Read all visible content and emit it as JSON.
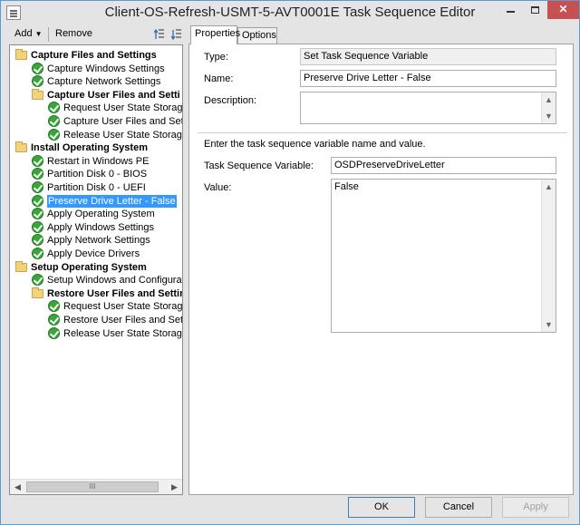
{
  "window": {
    "title": "Client-OS-Refresh-USMT-5-AVT0001E Task Sequence Editor"
  },
  "toolbar": {
    "add_label": "Add",
    "remove_label": "Remove"
  },
  "tree": {
    "items": [
      {
        "label": "Capture Files and Settings",
        "type": "group",
        "level": 0
      },
      {
        "label": "Capture Windows Settings",
        "type": "step",
        "level": 1
      },
      {
        "label": "Capture Network Settings",
        "type": "step",
        "level": 1
      },
      {
        "label": "Capture User Files and Setti",
        "type": "group",
        "level": 1
      },
      {
        "label": "Request User State Storage",
        "type": "step",
        "level": 2
      },
      {
        "label": "Capture User Files and Setting",
        "type": "step",
        "level": 2
      },
      {
        "label": "Release User State Storage",
        "type": "step",
        "level": 2
      },
      {
        "label": "Install Operating System",
        "type": "group",
        "level": 0
      },
      {
        "label": "Restart in Windows PE",
        "type": "step",
        "level": 1
      },
      {
        "label": "Partition Disk 0 - BIOS",
        "type": "step",
        "level": 1
      },
      {
        "label": "Partition Disk 0 - UEFI",
        "type": "step",
        "level": 1
      },
      {
        "label": "Preserve Drive Letter - False",
        "type": "step",
        "level": 1,
        "selected": true
      },
      {
        "label": "Apply Operating System",
        "type": "step",
        "level": 1
      },
      {
        "label": "Apply Windows Settings",
        "type": "step",
        "level": 1
      },
      {
        "label": "Apply Network Settings",
        "type": "step",
        "level": 1
      },
      {
        "label": "Apply Device Drivers",
        "type": "step",
        "level": 1
      },
      {
        "label": "Setup Operating System",
        "type": "group",
        "level": 0
      },
      {
        "label": "Setup Windows and Configuration",
        "type": "step",
        "level": 1
      },
      {
        "label": "Restore User Files and Settin",
        "type": "group",
        "level": 1
      },
      {
        "label": "Request User State Storage",
        "type": "step",
        "level": 2
      },
      {
        "label": "Restore User Files and Setting",
        "type": "step",
        "level": 2
      },
      {
        "label": "Release User State Storage",
        "type": "step",
        "level": 2
      }
    ],
    "scroll_thumb_label": "III"
  },
  "tabs": {
    "properties": "Properties",
    "options": "Options"
  },
  "properties": {
    "type_label": "Type:",
    "type_value": "Set Task Sequence Variable",
    "name_label": "Name:",
    "name_value": "Preserve Drive Letter - False",
    "description_label": "Description:",
    "description_value": "",
    "instruction": "Enter the task sequence variable name and value.",
    "variable_label": "Task Sequence Variable:",
    "variable_value": "OSDPreserveDriveLetter",
    "value_label": "Value:",
    "value_value": "False"
  },
  "buttons": {
    "ok": "OK",
    "cancel": "Cancel",
    "apply": "Apply"
  }
}
